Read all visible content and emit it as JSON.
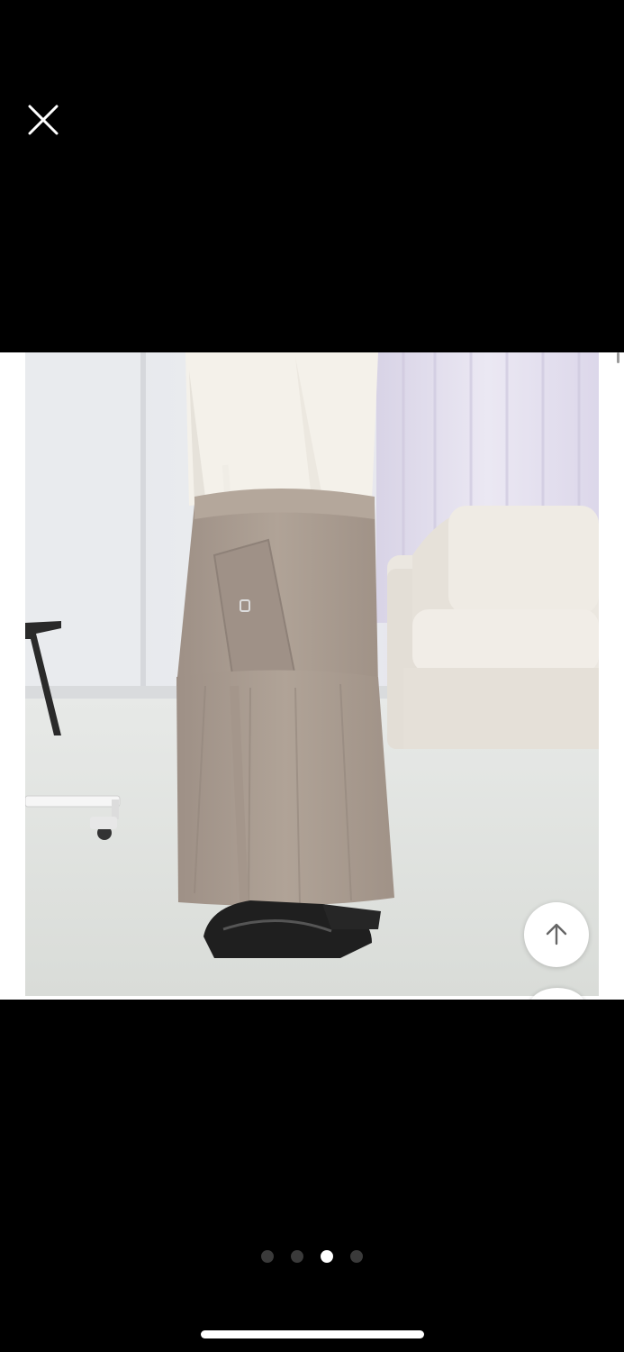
{
  "viewer": {
    "close_icon": "close-icon",
    "scroll_to_top_icon": "arrow-up-icon"
  },
  "gallery": {
    "image_count": 4,
    "active_index": 2,
    "image_description_icon": "product-photo"
  },
  "colors": {
    "background": "#000000",
    "skirt": "#a89a8e",
    "indicator_active": "#ffffff",
    "indicator_inactive": "#3a3a3a"
  }
}
